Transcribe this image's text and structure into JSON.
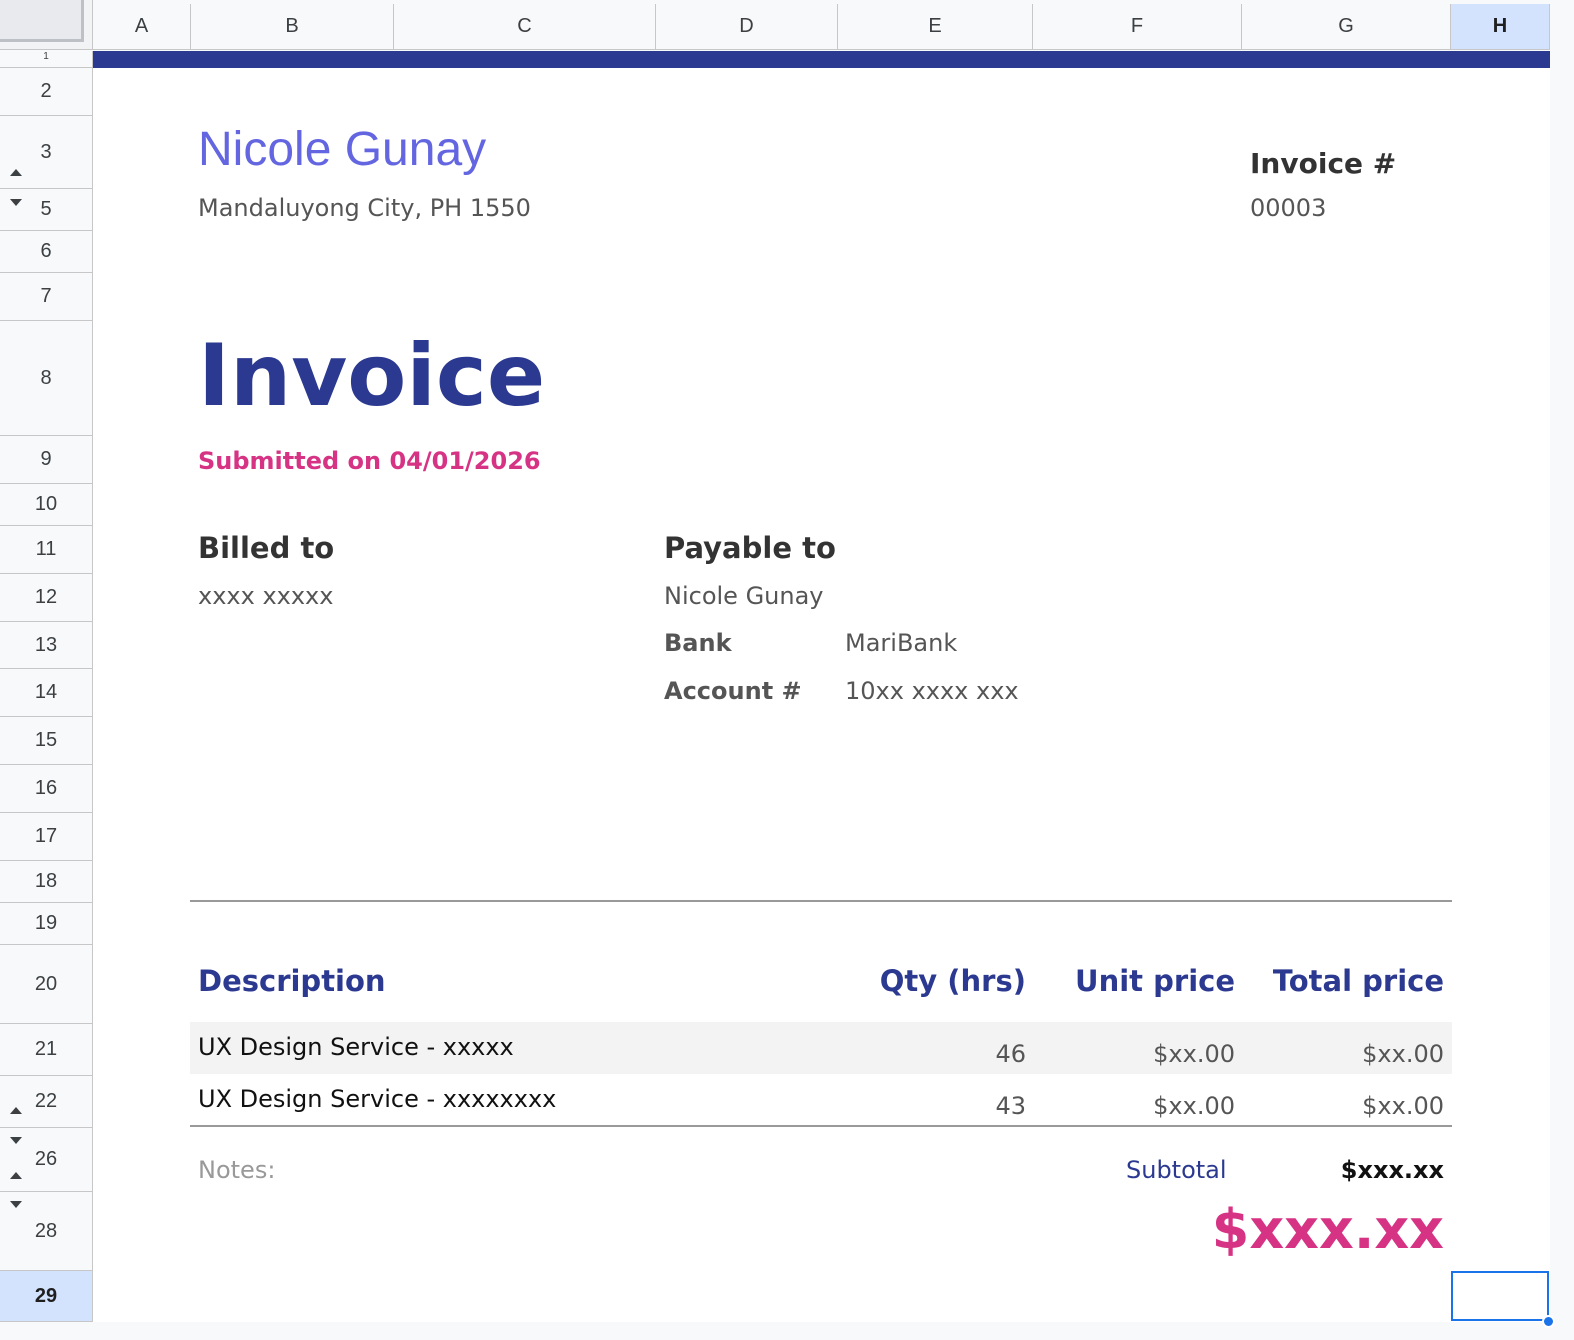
{
  "columns": [
    "A",
    "B",
    "C",
    "D",
    "E",
    "F",
    "G",
    "H"
  ],
  "active_column": "H",
  "rows": [
    "1",
    "2",
    "3",
    "5",
    "6",
    "7",
    "8",
    "9",
    "10",
    "11",
    "12",
    "13",
    "14",
    "15",
    "16",
    "17",
    "18",
    "19",
    "20",
    "21",
    "22",
    "26",
    "28",
    "29"
  ],
  "active_row": "29",
  "header": {
    "name": "Nicole Gunay",
    "address": "Mandaluyong City, PH 1550",
    "invoice_number_label": "Invoice #",
    "invoice_number": "00003"
  },
  "title": "Invoice",
  "submitted": "Submitted on 04/01/2026",
  "billed": {
    "heading": "Billed to",
    "name": "xxxx xxxxx"
  },
  "payable": {
    "heading": "Payable to",
    "name": "Nicole Gunay",
    "bank_label": "Bank",
    "bank_value": "MariBank",
    "account_label": "Account #",
    "account_value": "10xx xxxx xxx"
  },
  "table": {
    "headers": {
      "description": "Description",
      "qty": "Qty (hrs)",
      "unit_price": "Unit price",
      "total_price": "Total price"
    },
    "items": [
      {
        "description": "UX Design Service - xxxxx",
        "qty": "46",
        "unit_price": "$xx.00",
        "total_price": "$xx.00"
      },
      {
        "description": "UX Design Service - xxxxxxxx",
        "qty": "43",
        "unit_price": "$xx.00",
        "total_price": "$xx.00"
      }
    ]
  },
  "footer": {
    "notes_label": "Notes:",
    "subtotal_label": "Subtotal",
    "subtotal_value": "$xxx.xx",
    "grand_total": "$xxx.xx"
  },
  "colors": {
    "accent_navy": "#2b3990",
    "accent_pink": "#d63384",
    "name_purple": "#6366e0",
    "selection_blue": "#1a73e8"
  }
}
